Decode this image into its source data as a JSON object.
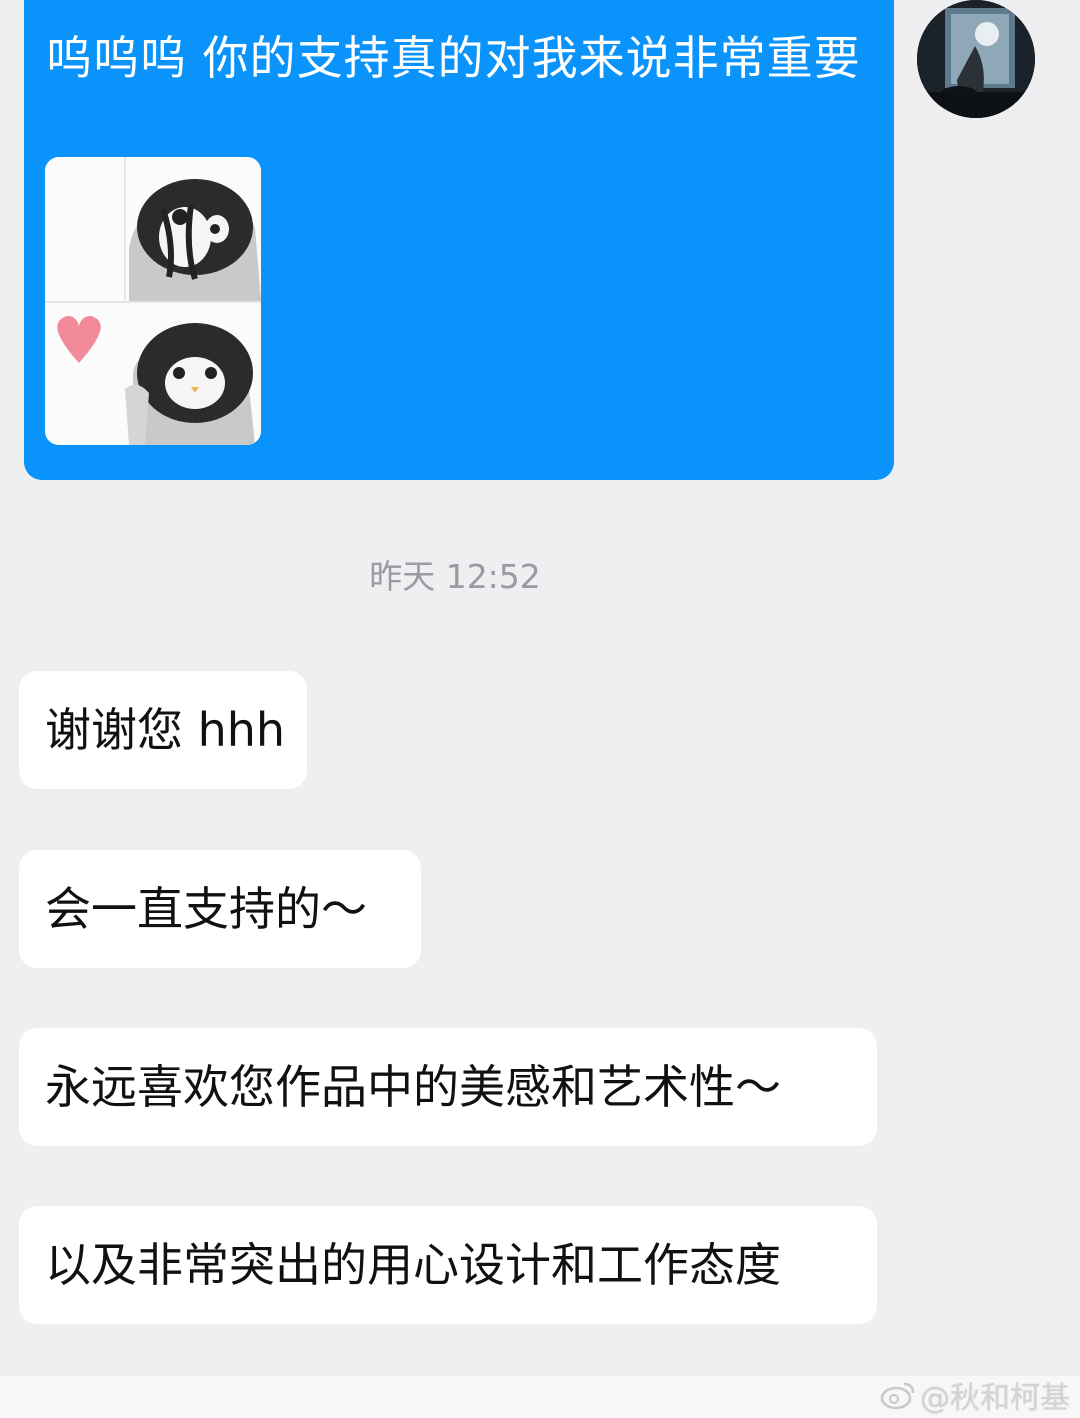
{
  "outgoing_message": {
    "text": "呜呜呜 你的支持真的对我来说非常重要",
    "sticker": "penguin-heart-sticker",
    "bubble_color": "#0a93fa"
  },
  "timestamp": "昨天 12:52",
  "incoming_messages": [
    {
      "text": "谢谢您 hhh"
    },
    {
      "text": "会一直支持的～"
    },
    {
      "text": "永远喜欢您作品中的美感和艺术性～"
    },
    {
      "text": "以及非常突出的用心设计和工作态度"
    }
  ],
  "watermark": {
    "text": "@秋和柯基",
    "icon": "weibo-icon"
  },
  "colors": {
    "background": "#efeff1",
    "incoming_bubble": "#ffffff",
    "timestamp": "#999ba0",
    "heart": "#f28a9a"
  }
}
